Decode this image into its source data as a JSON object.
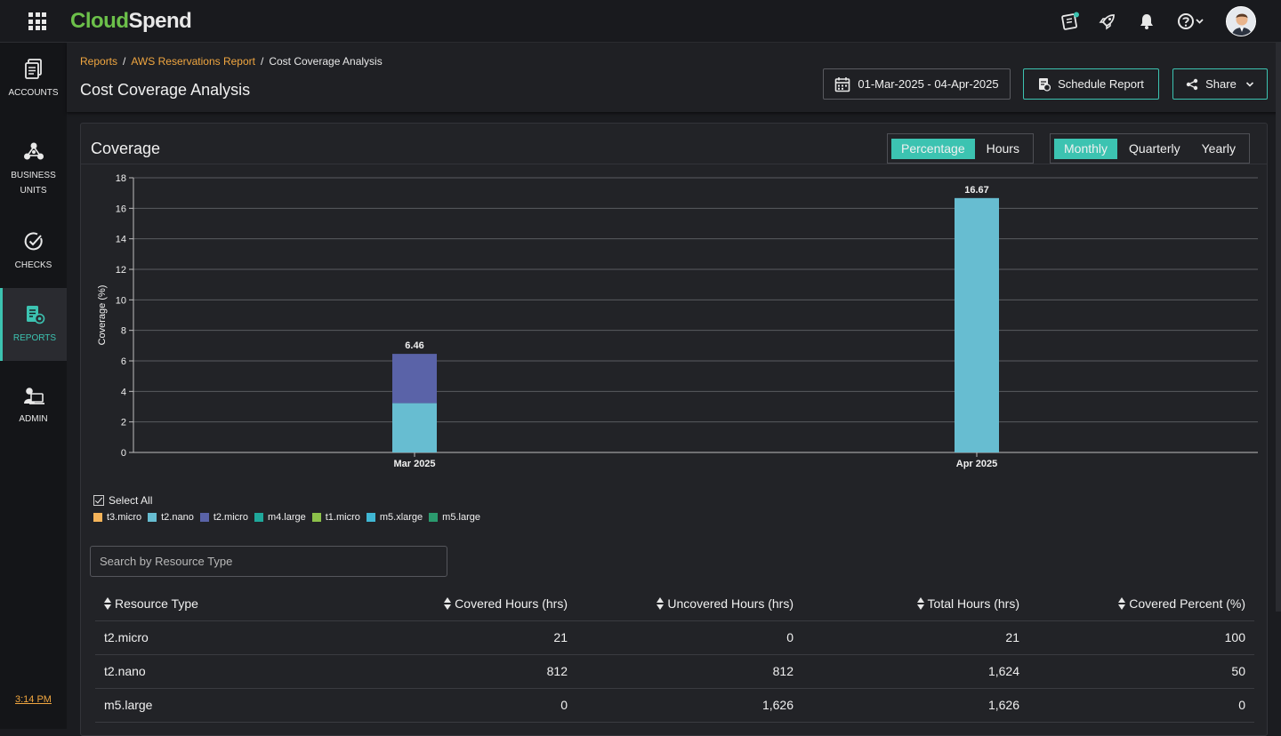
{
  "app": {
    "logo_part1": "Cloud",
    "logo_part2": "Spend"
  },
  "sidebar": {
    "items": [
      {
        "label": "ACCOUNTS",
        "icon": "accounts-icon"
      },
      {
        "label": "BUSINESS UNITS",
        "icon": "business-units-icon"
      },
      {
        "label": "CHECKS",
        "icon": "checks-icon"
      },
      {
        "label": "REPORTS",
        "icon": "reports-icon"
      },
      {
        "label": "ADMIN",
        "icon": "admin-icon"
      }
    ],
    "time": "3:14 PM"
  },
  "header": {
    "breadcrumb": [
      "Reports",
      "AWS Reservations Report",
      "Cost Coverage Analysis"
    ],
    "title": "Cost Coverage Analysis",
    "date_range": "01-Mar-2025 - 04-Apr-2025",
    "schedule_label": "Schedule Report",
    "share_label": "Share"
  },
  "card": {
    "title": "Coverage",
    "metric_toggle": [
      "Percentage",
      "Hours"
    ],
    "metric_selected": "Percentage",
    "period_toggle": [
      "Monthly",
      "Quarterly",
      "Yearly"
    ],
    "period_selected": "Monthly"
  },
  "chart_data": {
    "type": "bar",
    "stacked": true,
    "categories": [
      "Mar 2025",
      "Apr 2025"
    ],
    "series": [
      {
        "name": "t2.nano",
        "color": "#67bdd1",
        "values": [
          3.23,
          16.67
        ]
      },
      {
        "name": "t2.micro",
        "color": "#5a63a8",
        "values": [
          3.23,
          0
        ]
      }
    ],
    "totals": [
      6.46,
      16.67
    ],
    "ylabel": "Coverage (%)",
    "ylim": [
      0,
      18
    ],
    "yticks": [
      0,
      2,
      4,
      6,
      8,
      10,
      12,
      14,
      16,
      18
    ],
    "grid": true
  },
  "legend": {
    "select_all": "Select All",
    "items": [
      {
        "name": "t3.micro",
        "color": "#f5b45a"
      },
      {
        "name": "t2.nano",
        "color": "#67bdd1"
      },
      {
        "name": "t2.micro",
        "color": "#5a63a8"
      },
      {
        "name": "m4.large",
        "color": "#1fa89b"
      },
      {
        "name": "t1.micro",
        "color": "#8cc04a"
      },
      {
        "name": "m5.xlarge",
        "color": "#40b7d4"
      },
      {
        "name": "m5.large",
        "color": "#2b9a6e"
      }
    ]
  },
  "search": {
    "placeholder": "Search by Resource Type",
    "value": ""
  },
  "table": {
    "headers": [
      "Resource Type",
      "Covered Hours (hrs)",
      "Uncovered Hours (hrs)",
      "Total Hours (hrs)",
      "Covered Percent (%)"
    ],
    "rows": [
      [
        "t2.micro",
        "21",
        "0",
        "21",
        "100"
      ],
      [
        "t2.nano",
        "812",
        "812",
        "1,624",
        "50"
      ],
      [
        "m5.large",
        "0",
        "1,626",
        "1,626",
        "0"
      ]
    ]
  }
}
